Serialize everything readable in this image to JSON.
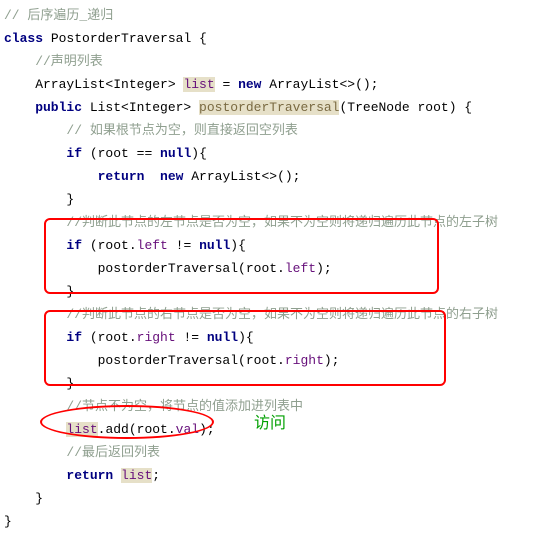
{
  "lines": {
    "l0": "// 后序遍历_递归",
    "l1_kw": "class",
    "l1_name": " PostorderTraversal {",
    "l2": "    //声明列表",
    "l3_a": "    ArrayList<Integer> ",
    "l3_list": "list",
    "l3_b": " = ",
    "l3_new": "new",
    "l3_c": " ArrayList<>();",
    "l4_pub": "    public",
    "l4_a": " List<Integer> ",
    "l4_m": "postorderTraversal",
    "l4_b": "(TreeNode root) {",
    "l5": "        // 如果根节点为空，则直接返回空列表",
    "l6_a": "        ",
    "l6_if": "if",
    "l6_b": " (root == ",
    "l6_null": "null",
    "l6_c": "){",
    "l7_a": "            ",
    "l7_ret": "return",
    "l7_b": "  ",
    "l7_new": "new",
    "l7_c": " ArrayList<>();",
    "l8": "        }",
    "l9": "        //判断此节点的左节点是否为空，如果不为空则将递归遍历此节点的左子树",
    "l10_a": "        ",
    "l10_if": "if",
    "l10_b": " (root.",
    "l10_left": "left",
    "l10_c": " != ",
    "l10_null": "null",
    "l10_d": "){",
    "l11_a": "            postorderTraversal(root.",
    "l11_left": "left",
    "l11_b": ");",
    "l12": "        }",
    "l13": "        //判断此节点的右节点是否为空，如果不为空则将递归遍历此节点的右子树",
    "l14_a": "        ",
    "l14_if": "if",
    "l14_b": " (root.",
    "l14_right": "right",
    "l14_c": " != ",
    "l14_null": "null",
    "l14_d": "){",
    "l15_a": "            postorderTraversal(root.",
    "l15_right": "right",
    "l15_b": ");",
    "l16": "        }",
    "l17": "        //节点不为空，将节点的值添加进列表中",
    "l18_a": "        ",
    "l18_list": "list",
    "l18_b": ".add(root.",
    "l18_val": "val",
    "l18_c": ");",
    "l19": "        //最后返回列表",
    "l20_a": "        ",
    "l20_ret": "return",
    "l20_b": " ",
    "l20_list": "list",
    "l20_c": ";",
    "l21": "    }",
    "l22": "}"
  },
  "annotation": "访问"
}
